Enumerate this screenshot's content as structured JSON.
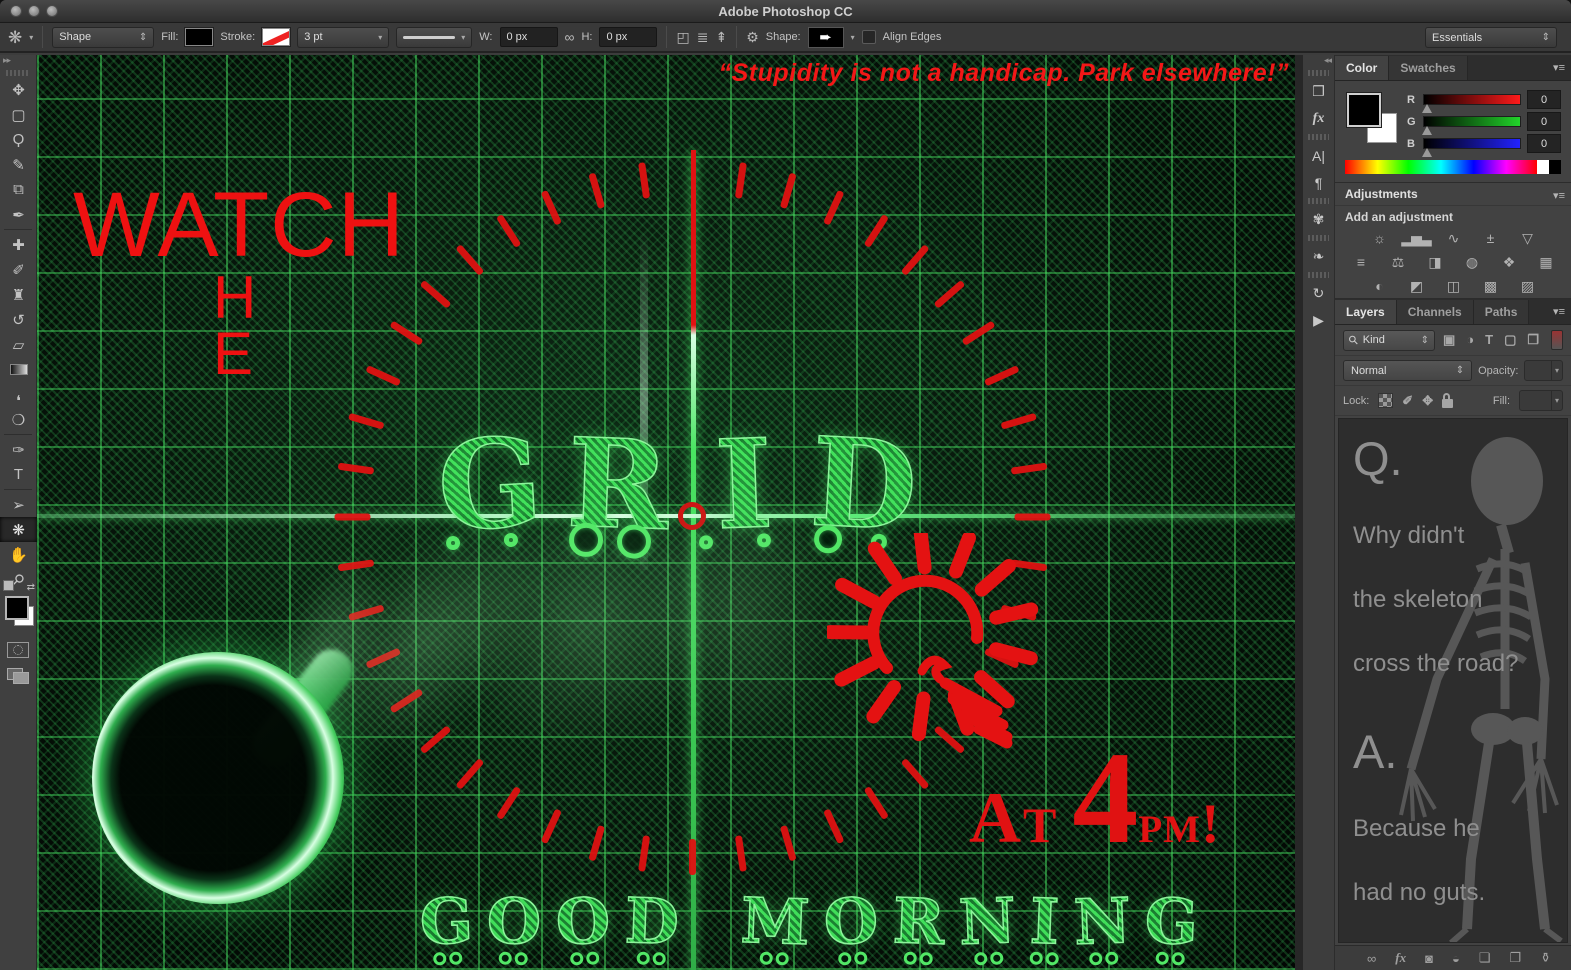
{
  "window": {
    "title": "Adobe Photoshop CC"
  },
  "options_bar": {
    "tool_glyph": "❋",
    "mode_value": "Shape",
    "fill_label": "Fill:",
    "stroke_label": "Stroke:",
    "stroke_width_value": "3 pt",
    "width_label": "W:",
    "width_value": "0 px",
    "link_glyph": "∞",
    "height_label": "H:",
    "height_value": "0 px",
    "path_ops_glyph": "◰",
    "align_glyph": "≣",
    "arrange_glyph": "⇞",
    "gear_glyph": "⚙",
    "shape_label": "Shape:",
    "shape_preview_glyph": "➨",
    "align_edges_label": "Align Edges",
    "workspace_value": "Essentials"
  },
  "toolbar": {
    "tools": [
      {
        "name": "move-tool",
        "glyph": "✥"
      },
      {
        "name": "rectangular-marquee-tool",
        "glyph": "▢"
      },
      {
        "name": "lasso-tool",
        "glyph": "Ϙ"
      },
      {
        "name": "quick-selection-tool",
        "glyph": "✎"
      },
      {
        "name": "crop-tool",
        "glyph": "⧉"
      },
      {
        "name": "eyedropper-tool",
        "glyph": "✒"
      },
      {
        "name": "healing-brush-tool",
        "glyph": "✚"
      },
      {
        "name": "brush-tool",
        "glyph": "✐"
      },
      {
        "name": "clone-stamp-tool",
        "glyph": "♜"
      },
      {
        "name": "history-brush-tool",
        "glyph": "↺"
      },
      {
        "name": "eraser-tool",
        "glyph": "▱"
      },
      {
        "name": "gradient-tool",
        "glyph": "css-gradient"
      },
      {
        "name": "blur-tool",
        "glyph": "❜"
      },
      {
        "name": "dodge-tool",
        "glyph": "❍"
      },
      {
        "name": "pen-tool",
        "glyph": "✑"
      },
      {
        "name": "type-tool",
        "glyph": "T"
      },
      {
        "name": "path-selection-tool",
        "glyph": "➢"
      },
      {
        "name": "custom-shape-tool",
        "glyph": "❋",
        "selected": true
      },
      {
        "name": "hand-tool",
        "glyph": "✋"
      },
      {
        "name": "zoom-tool",
        "glyph": "⚲"
      }
    ]
  },
  "side_strip": {
    "icons": [
      {
        "name": "properties-panel-icon",
        "glyph": "❒"
      },
      {
        "name": "styles-panel-icon",
        "glyph": "fx"
      },
      {
        "name": "character-panel-icon",
        "glyph": "A|"
      },
      {
        "name": "paragraph-panel-icon",
        "glyph": "¶"
      },
      {
        "name": "brush-panel-icon",
        "glyph": "✾"
      },
      {
        "name": "clone-source-panel-icon",
        "glyph": "❧"
      },
      {
        "name": "history-panel-icon",
        "glyph": "↻"
      },
      {
        "name": "actions-panel-icon",
        "glyph": "▶"
      }
    ]
  },
  "color_panel": {
    "tabs": [
      "Color",
      "Swatches"
    ],
    "channels": [
      {
        "label": "R",
        "value": "0",
        "to": "#ff1a1a"
      },
      {
        "label": "G",
        "value": "0",
        "to": "#22d42a"
      },
      {
        "label": "B",
        "value": "0",
        "to": "#2222ff"
      }
    ]
  },
  "adjustments_panel": {
    "title": "Adjustments",
    "subtitle": "Add an adjustment",
    "rows": [
      [
        {
          "name": "brightness-contrast-icon",
          "glyph": "☼"
        },
        {
          "name": "levels-icon",
          "glyph": "▂▅▃"
        },
        {
          "name": "curves-icon",
          "glyph": "∿"
        },
        {
          "name": "exposure-icon",
          "glyph": "±"
        },
        {
          "name": "vibrance-icon",
          "glyph": "▽"
        }
      ],
      [
        {
          "name": "hue-saturation-icon",
          "glyph": "≡"
        },
        {
          "name": "color-balance-icon",
          "glyph": "⚖"
        },
        {
          "name": "black-white-icon",
          "glyph": "◨"
        },
        {
          "name": "photo-filter-icon",
          "glyph": "◍"
        },
        {
          "name": "channel-mixer-icon",
          "glyph": "❖"
        },
        {
          "name": "color-lookup-icon",
          "glyph": "▦"
        }
      ],
      [
        {
          "name": "invert-icon",
          "glyph": "◐"
        },
        {
          "name": "posterize-icon",
          "glyph": "◩"
        },
        {
          "name": "threshold-icon",
          "glyph": "◫"
        },
        {
          "name": "gradient-map-icon",
          "glyph": "▩"
        },
        {
          "name": "selective-color-icon",
          "glyph": "▨"
        }
      ]
    ]
  },
  "layers_panel": {
    "tabs": [
      "Layers",
      "Channels",
      "Paths"
    ],
    "search_label": "Kind",
    "filter_icons": [
      {
        "name": "filter-pixel-layers-icon",
        "glyph": "▣"
      },
      {
        "name": "filter-adjustment-layers-icon",
        "glyph": "◑"
      },
      {
        "name": "filter-type-layers-icon",
        "glyph": "T"
      },
      {
        "name": "filter-shape-layers-icon",
        "glyph": "▢"
      },
      {
        "name": "filter-smart-objects-icon",
        "glyph": "❐"
      }
    ],
    "blend_mode_value": "Normal",
    "opacity_label": "Opacity:",
    "lock_label": "Lock:",
    "fill_label": "Fill:",
    "bottom_icons": [
      {
        "name": "link-layers-icon",
        "glyph": "∞"
      },
      {
        "name": "layer-style-icon",
        "glyph": "fx"
      },
      {
        "name": "layer-mask-icon",
        "glyph": "◙"
      },
      {
        "name": "adjustment-layer-icon",
        "glyph": "◒"
      },
      {
        "name": "new-group-icon",
        "glyph": "❏"
      },
      {
        "name": "new-layer-icon",
        "glyph": "❐"
      },
      {
        "name": "delete-layer-icon",
        "glyph": "⚱"
      }
    ],
    "joke": {
      "q_label": "Q.",
      "q_lines": [
        "Why didn't",
        "the skeleton",
        "cross the road?"
      ],
      "a_label": "A.",
      "a_lines": [
        "Because he",
        "had no guts."
      ]
    }
  },
  "canvas": {
    "quote": "“Stupidity is not a handicap. Park elsewhere!”",
    "watch_text": "WATCH",
    "the_letters": [
      "H",
      "E"
    ],
    "grid_letters": [
      "G",
      "R",
      "I",
      "D"
    ],
    "morning_text": "GOOD MORNING",
    "time": {
      "at": "At",
      "hour": "4",
      "suffix": "pm!"
    },
    "colors": {
      "red": "#e31313",
      "green": "#57ea6a"
    }
  }
}
